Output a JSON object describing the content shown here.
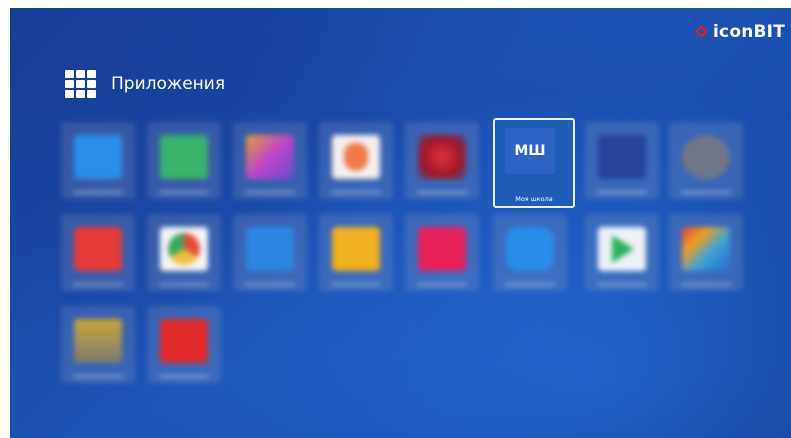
{
  "brand": {
    "name": "iconBIT",
    "mark_color": "#e02020"
  },
  "header": {
    "title": "Приложения",
    "icon": "apps-grid-icon"
  },
  "selected_app": {
    "icon_text": "МШ",
    "label": "Моя школа"
  },
  "apps": [
    {
      "icon": "search-app-icon",
      "color": "#2d8ee8"
    },
    {
      "icon": "green-app-icon",
      "color": "#3bb36a"
    },
    {
      "icon": "gallery-app-icon",
      "color": "#c045c8"
    },
    {
      "icon": "red-badge-app-icon",
      "color": "#f07a4a"
    },
    {
      "icon": "red-logo-app-icon",
      "color": "#d02030"
    },
    {
      "icon": "moya-shkola-app-icon",
      "color": "#2b62c4"
    },
    {
      "icon": "blue-dark-app-icon",
      "color": "#2d5ab8"
    },
    {
      "icon": "grey-round-app-icon",
      "color": "#707888"
    },
    {
      "icon": "red-media-app-icon",
      "color": "#e43a35"
    },
    {
      "icon": "chrome-app-icon",
      "color": "#e8c040"
    },
    {
      "icon": "blue-file-app-icon",
      "color": "#2f86e0"
    },
    {
      "icon": "yellow-app-icon",
      "color": "#f0b020"
    },
    {
      "icon": "pink-app-icon",
      "color": "#e8205a"
    },
    {
      "icon": "cloud-app-icon",
      "color": "#2a8ee8"
    },
    {
      "icon": "play-store-app-icon",
      "color": "#e8f0f8"
    },
    {
      "icon": "colorful-app-icon",
      "color": "#3aa2d8"
    },
    {
      "icon": "olive-app-icon",
      "color": "#b8a050"
    },
    {
      "icon": "youtube-app-icon",
      "color": "#e02a28"
    }
  ]
}
